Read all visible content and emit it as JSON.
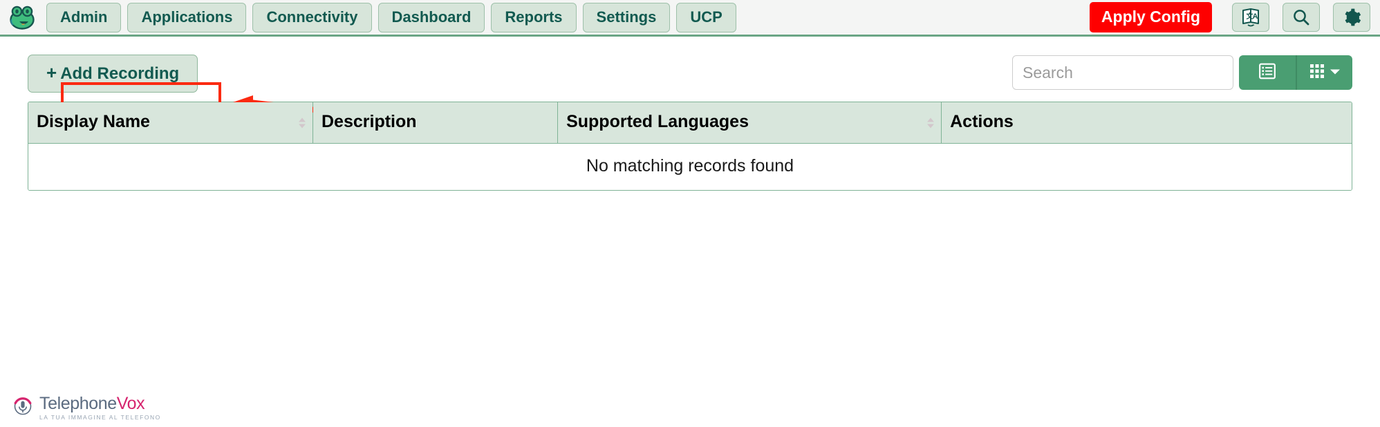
{
  "navbar": {
    "logo_icon": "freepbx-frog-icon",
    "items": [
      {
        "label": "Admin",
        "name": "nav-admin"
      },
      {
        "label": "Applications",
        "name": "nav-applications"
      },
      {
        "label": "Connectivity",
        "name": "nav-connectivity"
      },
      {
        "label": "Dashboard",
        "name": "nav-dashboard"
      },
      {
        "label": "Reports",
        "name": "nav-reports"
      },
      {
        "label": "Settings",
        "name": "nav-settings"
      },
      {
        "label": "UCP",
        "name": "nav-ucp"
      }
    ],
    "apply_config_label": "Apply Config",
    "apply_config_color": "#fe0000",
    "icons": [
      {
        "name": "translate-icon"
      },
      {
        "name": "search-icon"
      },
      {
        "name": "gear-icon"
      }
    ],
    "button_bg": "#d7e5da",
    "button_text_color": "#125a50",
    "border_color": "#6aa585"
  },
  "toolbar": {
    "add_recording_label": "Add Recording",
    "add_recording_plus": "+",
    "search_placeholder": "Search",
    "search_value": "",
    "view_buttons": [
      {
        "name": "list-view-button",
        "icon": "list-view-icon"
      },
      {
        "name": "grid-view-button",
        "icon": "grid-view-icon"
      }
    ],
    "view_button_color": "#4a9e72"
  },
  "annotation": {
    "highlight_color": "#fb2a11",
    "target": "add-recording-button",
    "arrow_direction": "left"
  },
  "table": {
    "columns": [
      {
        "label": "Display Name",
        "sortable": true
      },
      {
        "label": "Description",
        "sortable": false
      },
      {
        "label": "Supported Languages",
        "sortable": true
      },
      {
        "label": "Actions",
        "sortable": false
      }
    ],
    "rows": [],
    "empty_message": "No matching records found",
    "header_bg": "#d8e6dc",
    "border_color": "#7fb396"
  },
  "footer": {
    "logo_icon": "microphone-logo-icon",
    "brand_part1": "Telephone",
    "brand_part2": "Vox",
    "tagline": "LA TUA IMMAGINE AL TELEFONO",
    "brand_color_1": "#5b6b80",
    "brand_color_2": "#d6246e"
  }
}
